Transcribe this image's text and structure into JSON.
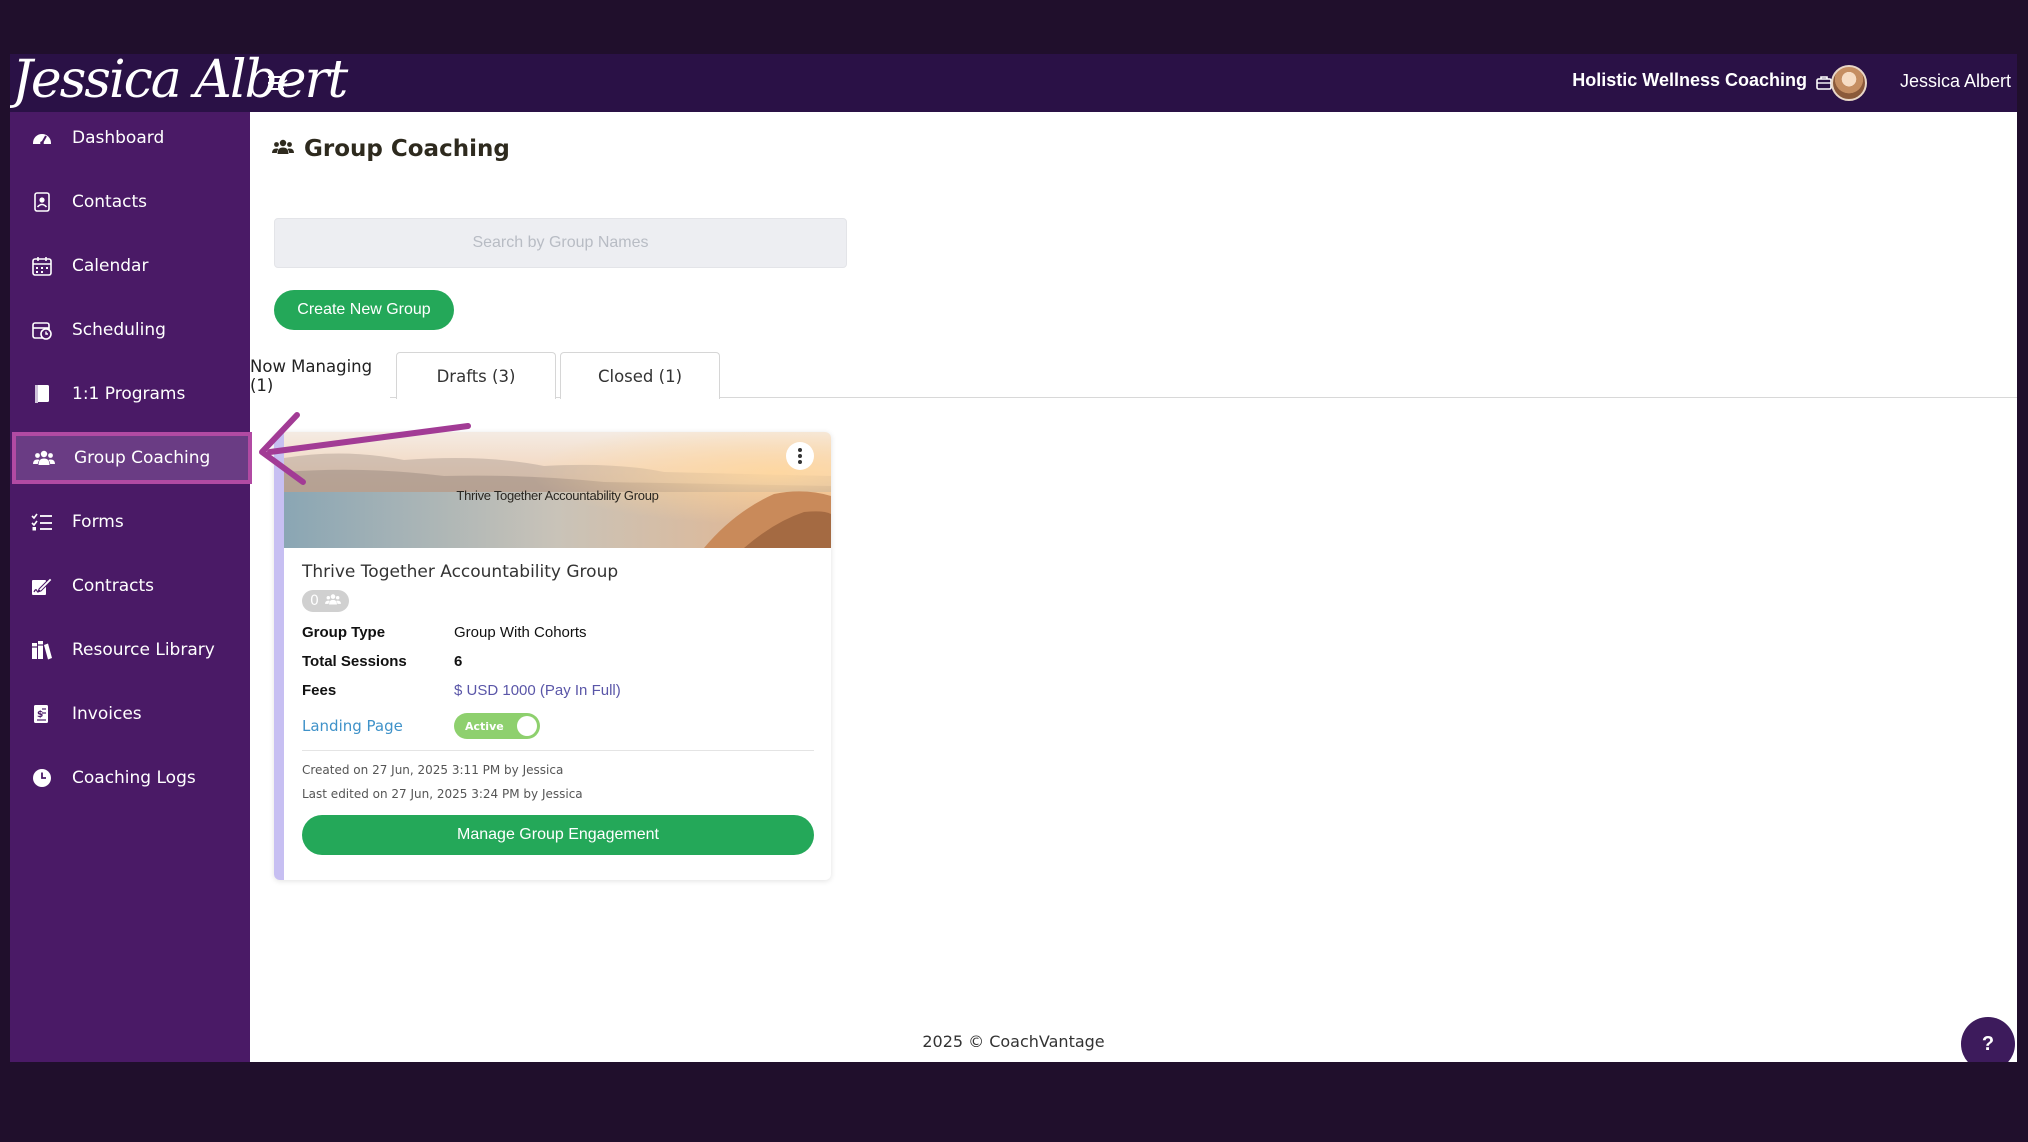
{
  "header": {
    "logo_text": "Jessica Albert",
    "business_name": "Holistic Wellness Coaching",
    "user_name": "Jessica Albert"
  },
  "sidebar": {
    "items": [
      {
        "label": "Dashboard",
        "icon": "dashboard-icon"
      },
      {
        "label": "Contacts",
        "icon": "contacts-icon"
      },
      {
        "label": "Calendar",
        "icon": "calendar-icon"
      },
      {
        "label": "Scheduling",
        "icon": "scheduling-icon"
      },
      {
        "label": "1:1 Programs",
        "icon": "book-icon"
      },
      {
        "label": "Group Coaching",
        "icon": "users-icon",
        "active": true
      },
      {
        "label": "Forms",
        "icon": "checklist-icon"
      },
      {
        "label": "Contracts",
        "icon": "signature-icon"
      },
      {
        "label": "Resource Library",
        "icon": "library-icon"
      },
      {
        "label": "Invoices",
        "icon": "invoice-icon"
      },
      {
        "label": "Coaching Logs",
        "icon": "clock-icon"
      }
    ]
  },
  "page": {
    "title": "Group Coaching",
    "search_placeholder": "Search by Group Names",
    "create_button": "Create New Group"
  },
  "tabs": [
    {
      "label": "Now Managing (1)",
      "active": true
    },
    {
      "label": "Drafts (3)"
    },
    {
      "label": "Closed (1)"
    }
  ],
  "card": {
    "banner_text": "Thrive Together Accountability Group",
    "title": "Thrive Together Accountability Group",
    "member_count": "0",
    "group_type_label": "Group Type",
    "group_type_value": "Group With Cohorts",
    "sessions_label": "Total Sessions",
    "sessions_value": "6",
    "fees_label": "Fees",
    "fees_value": "$ USD 1000 (Pay In Full)",
    "landing_label": "Landing Page",
    "landing_status": "Active",
    "created": "Created on 27 Jun, 2025 3:11 PM by Jessica",
    "edited": "Last edited on 27 Jun, 2025 3:24 PM by Jessica",
    "manage_button": "Manage Group Engagement"
  },
  "footer": {
    "text": "2025 © CoachVantage",
    "help_label": "?"
  },
  "colors": {
    "sidebar": "#4a1a66",
    "topbar": "#2a1146",
    "primary_button": "#24a859",
    "highlight": "#b14aa3",
    "card_accent": "#c7bff2"
  }
}
